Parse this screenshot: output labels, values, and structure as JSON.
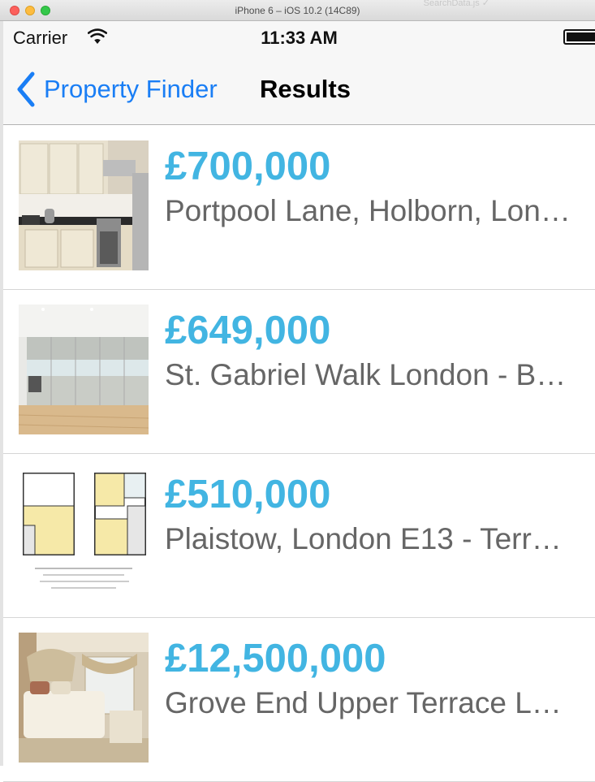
{
  "window": {
    "title": "iPhone 6 – iOS 10.2 (14C89)",
    "background_hint": "SearchData.js ✓"
  },
  "status_bar": {
    "carrier": "Carrier",
    "time": "11:33 AM",
    "wifi_icon": "wifi-icon",
    "battery_icon": "battery-icon"
  },
  "nav": {
    "back_label": "Property Finder",
    "back_icon": "chevron-left-icon",
    "title": "Results"
  },
  "colors": {
    "accent": "#1a7ef5",
    "price": "#42b5e2",
    "subtitle": "#666666"
  },
  "listings": [
    {
      "price": "£700,000",
      "title": "Portpool Lane, Holborn, Lon…",
      "thumbnail": "kitchen-photo"
    },
    {
      "price": "£649,000",
      "title": "St. Gabriel Walk London - B…",
      "thumbnail": "modern-kitchen-photo"
    },
    {
      "price": "£510,000",
      "title": "Plaistow, London E13 - Terr…",
      "thumbnail": "floorplan-image"
    },
    {
      "price": "£12,500,000",
      "title": "Grove End Upper Terrace L…",
      "thumbnail": "bedroom-photo"
    }
  ]
}
